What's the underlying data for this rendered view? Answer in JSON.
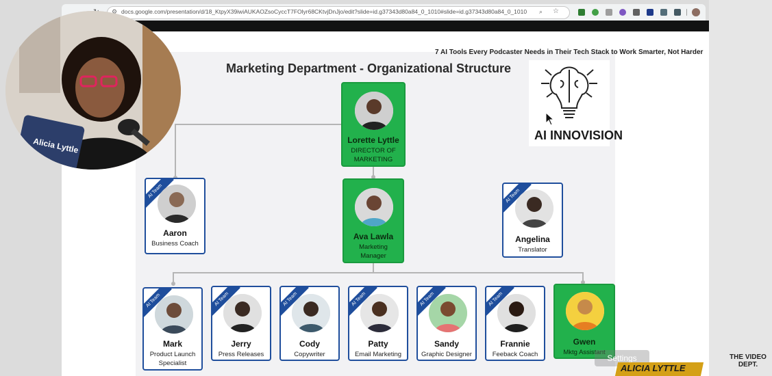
{
  "browser": {
    "url": "docs.google.com/presentation/d/18_KtpyX39iwiAUKAOZsoCyccT7FOlyr68CKtvjDnJjo/edit?slide=id.g37343d80a84_0_1010#slide=id.g37343d80a84_0_1010"
  },
  "slide": {
    "heading": "7 AI Tools Every Podcaster Needs in Their Tech Stack to Work Smarter, Not Harder",
    "chart_title": "Marketing Department - Organizational Structure",
    "logo_text": "AI INNOVISION"
  },
  "badge_label": "AI Team",
  "director": {
    "name": "Lorette Lyttle",
    "role": "DIRECTOR OF MARKETING"
  },
  "manager": {
    "name": "Ava Lawla",
    "role": "Marketing Manager"
  },
  "advisors": [
    {
      "name": "Aaron",
      "role": "Business Coach"
    },
    {
      "name": "Angelina",
      "role": "Translator"
    }
  ],
  "team": [
    {
      "name": "Mark",
      "role": "Product Launch Specialist"
    },
    {
      "name": "Jerry",
      "role": "Press Releases"
    },
    {
      "name": "Cody",
      "role": "Copywriter"
    },
    {
      "name": "Patty",
      "role": "Email Marketing"
    },
    {
      "name": "Sandy",
      "role": "Graphic Designer"
    },
    {
      "name": "Frannie",
      "role": "Feeback Coach"
    },
    {
      "name": "Gwen",
      "role": "Mktg Assistant"
    }
  ],
  "overlay": {
    "webcam_label": "Alicia Lyttle",
    "settings_label": "Settings",
    "lower_third": "ALICIA LYTTLE",
    "watermark": "THE VIDEO DEPT."
  },
  "colors": {
    "human_card": "#22b14c",
    "ai_card_border": "#1f4e9c"
  }
}
